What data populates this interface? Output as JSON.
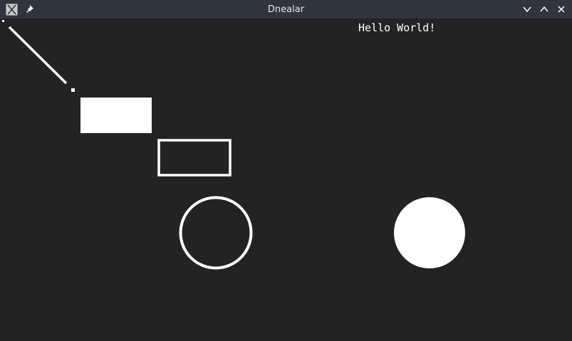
{
  "window": {
    "title": "Dnealar"
  },
  "titlebar": {
    "app_icon": "x11-icon",
    "pin_icon": "pin-icon",
    "buttons": [
      "minimize-chevron-down-icon",
      "maximize-chevron-up-icon",
      "close-x-icon"
    ]
  },
  "canvas": {
    "background": "#232323",
    "draw_color": "#ffffff",
    "text": "Hello World!"
  }
}
